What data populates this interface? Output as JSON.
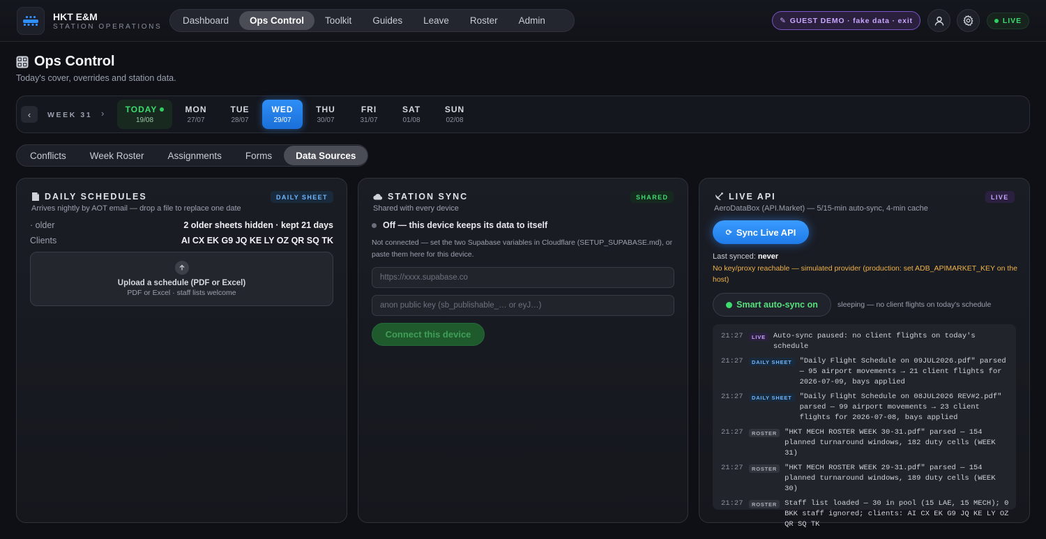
{
  "header": {
    "brand_name": "HKT E&M",
    "brand_sub": "STATION OPERATIONS",
    "nav": [
      "Dashboard",
      "Ops Control",
      "Toolkit",
      "Guides",
      "Leave",
      "Roster",
      "Admin"
    ],
    "active_nav": "Ops Control",
    "guest_label": "GUEST DEMO · fake data · exit",
    "live_label": "LIVE"
  },
  "page": {
    "title": "Ops Control",
    "subtitle": "Today's cover, overrides and station data."
  },
  "week": {
    "label": "WEEK 31",
    "prev": "‹",
    "next": "›",
    "days": [
      {
        "name": "TODAY",
        "date": "19/08"
      },
      {
        "name": "MON",
        "date": "27/07"
      },
      {
        "name": "TUE",
        "date": "28/07"
      },
      {
        "name": "WED",
        "date": "29/07"
      },
      {
        "name": "THU",
        "date": "30/07"
      },
      {
        "name": "FRI",
        "date": "31/07"
      },
      {
        "name": "SAT",
        "date": "01/08"
      },
      {
        "name": "SUN",
        "date": "02/08"
      }
    ]
  },
  "subtabs": [
    "Conflicts",
    "Week Roster",
    "Assignments",
    "Forms",
    "Data Sources"
  ],
  "daily": {
    "title": "DAILY SCHEDULES",
    "badge": "DAILY SHEET",
    "subtitle": "Arrives nightly by AOT email — drop a file to replace one date",
    "older_key": "· older",
    "older_val": "2 older sheets hidden · kept 21 days",
    "clients_key": "Clients",
    "clients_val": "AI CX EK G9 JQ KE LY OZ QR SQ TK",
    "upload_title": "Upload a schedule (PDF or Excel)",
    "upload_sub": "PDF or Excel · staff lists welcome"
  },
  "station": {
    "title": "STATION SYNC",
    "badge": "SHARED",
    "subtitle": "Shared with every device",
    "state": "Off — this device keeps its data to itself",
    "note": "Not connected — set the two Supabase variables in Cloudflare (SETUP_SUPABASE.md), or paste them here for this device.",
    "url_placeholder": "https://xxxx.supabase.co",
    "key_placeholder": "anon public key (sb_publishable_… or eyJ…)",
    "connect_label": "Connect this device"
  },
  "live": {
    "title": "LIVE API",
    "badge": "LIVE",
    "subtitle": "AeroDataBox (API.Market) — 5/15-min auto-sync, 4-min cache",
    "sync_label": "Sync Live API",
    "last_synced_label": "Last synced:",
    "last_synced_value": "never",
    "warning": "No key/proxy reachable — simulated provider (production: set ADB_APIMARKET_KEY on the host)",
    "auto_label": "Smart auto-sync on",
    "auto_note": "sleeping — no client flights on today's schedule",
    "log": [
      {
        "time": "21:27",
        "tag": "LIVE",
        "type": "live",
        "msg": "Auto-sync paused: no client flights on today's schedule"
      },
      {
        "time": "21:27",
        "tag": "DAILY SHEET",
        "type": "daily",
        "msg": "\"Daily Flight Schedule on 09JUL2026.pdf\" parsed — 95 airport movements → 21 client flights for 2026-07-09, bays applied"
      },
      {
        "time": "21:27",
        "tag": "DAILY SHEET",
        "type": "daily",
        "msg": "\"Daily Flight Schedule on 08JUL2026 REV#2.pdf\" parsed — 99 airport movements → 23 client flights for 2026-07-08, bays applied"
      },
      {
        "time": "21:27",
        "tag": "ROSTER",
        "type": "roster",
        "msg": "\"HKT MECH ROSTER WEEK 30-31.pdf\" parsed — 154 planned turnaround windows, 182 duty cells (WEEK 31)"
      },
      {
        "time": "21:27",
        "tag": "ROSTER",
        "type": "roster",
        "msg": "\"HKT MECH ROSTER WEEK 29-31.pdf\" parsed — 154 planned turnaround windows, 189 duty cells (WEEK 30)"
      },
      {
        "time": "21:27",
        "tag": "ROSTER",
        "type": "roster",
        "msg": "Staff list loaded — 30 in pool (15 LAE, 15 MECH); 0 BKK staff ignored; clients: AI CX EK G9 JQ KE LY OZ QR SQ TK"
      }
    ]
  }
}
